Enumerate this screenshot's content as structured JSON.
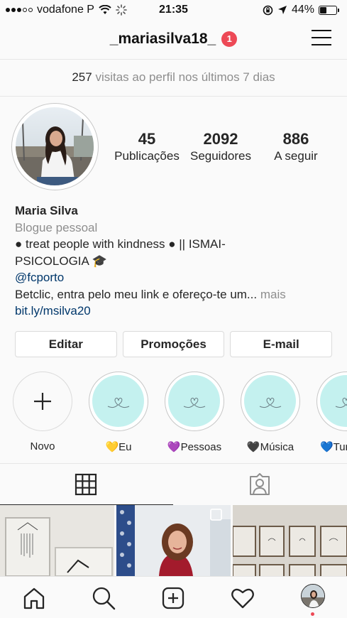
{
  "status_bar": {
    "carrier": "vodafone P",
    "time": "21:35",
    "battery": "44%",
    "battery_level": 0.44
  },
  "header": {
    "username": "_mariasilva18_",
    "notification_count": "1"
  },
  "insights": {
    "visits_count": "257",
    "visits_text": "visitas ao perfil nos últimos 7 dias"
  },
  "stats": [
    {
      "value": "45",
      "label": "Publicações"
    },
    {
      "value": "2092",
      "label": "Seguidores"
    },
    {
      "value": "886",
      "label": "A seguir"
    }
  ],
  "bio": {
    "name": "Maria Silva",
    "category": "Blogue pessoal",
    "line1": "● treat people with kindness ● || ISMAI-",
    "line2": "PSICOLOGIA 🎓",
    "mention": "@fcporto",
    "line3": "Betclic, entra pelo meu link e ofereço-te um...",
    "more": "mais",
    "link": "bit.ly/msilva20"
  },
  "actions": {
    "edit": "Editar",
    "promotions": "Promoções",
    "email": "E-mail"
  },
  "highlights": {
    "new_label": "Novo",
    "items": [
      {
        "label": "💛Eu"
      },
      {
        "label": "💜Pessoas"
      },
      {
        "label": "🖤Música"
      },
      {
        "label": "💙Tur"
      }
    ]
  },
  "colors": {
    "notification": "#ed4956",
    "highlight_bg": "#c4f1ef",
    "link": "#00376b"
  },
  "icons": {
    "grid_tab": "grid-icon",
    "tagged_tab": "tagged-person-icon",
    "home": "home-icon",
    "search": "search-icon",
    "add": "add-post-icon",
    "activity": "heart-icon"
  }
}
